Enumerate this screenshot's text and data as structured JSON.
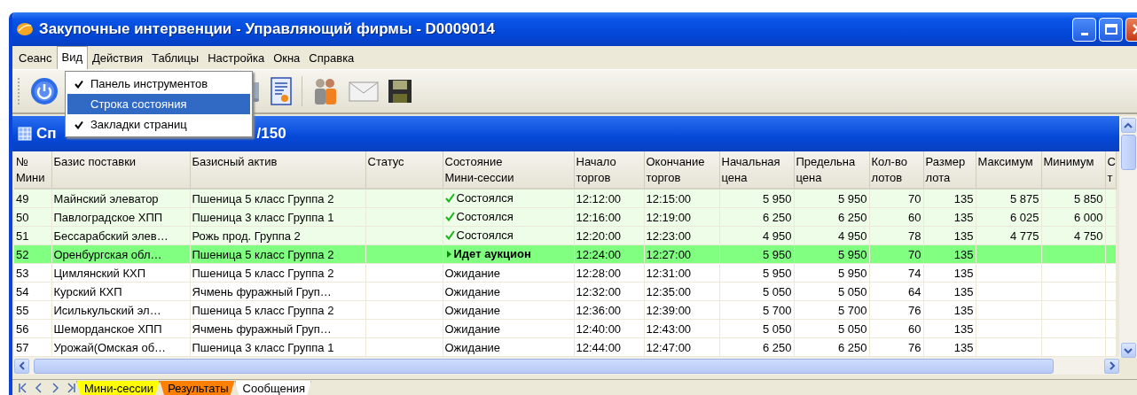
{
  "window": {
    "title": "Закупочные интервенции - Управляющий фирмы - D0009014"
  },
  "menu": [
    {
      "label": "Сеанс",
      "selected": false
    },
    {
      "label": "Вид",
      "selected": true
    },
    {
      "label": "Действия",
      "selected": false
    },
    {
      "label": "Таблицы",
      "selected": false
    },
    {
      "label": "Настройка",
      "selected": false
    },
    {
      "label": "Окна",
      "selected": false
    },
    {
      "label": "Справка",
      "selected": false
    }
  ],
  "dropdown": [
    {
      "label": "Панель инструментов",
      "checked": true,
      "selected": false
    },
    {
      "label": "Строка состояния",
      "checked": false,
      "selected": true
    },
    {
      "label": "Закладки страниц",
      "checked": true,
      "selected": false
    }
  ],
  "panel": {
    "title_start": "Сп",
    "title_end": "/150"
  },
  "table": {
    "columns": [
      {
        "label": "№\nМини"
      },
      {
        "label": "Базис поставки"
      },
      {
        "label": "Базисный актив"
      },
      {
        "label": "Статус"
      },
      {
        "label": "Состояние\nМини-сессии"
      },
      {
        "label": "Начало\nторгов"
      },
      {
        "label": "Окончание\nторгов"
      },
      {
        "label": "Начальная\nцена"
      },
      {
        "label": "Предельна\nцена"
      },
      {
        "label": "Кол-во\nлотов"
      },
      {
        "label": "Размер\nлота"
      },
      {
        "label": "Максимум"
      },
      {
        "label": "Минимум"
      },
      {
        "label": "С\nт"
      }
    ],
    "rows": [
      {
        "kind": "done",
        "no": "49",
        "basis": "Майнский элеватор",
        "asset": "Пшеница 5 класс Группа 2",
        "state": "Состоялся",
        "start": "12:12:00",
        "end": "12:15:00",
        "start_price": "5 950",
        "limit_price": "5 950",
        "lots": "70",
        "lot_size": "135",
        "max": "5 875",
        "min": "5 850"
      },
      {
        "kind": "done",
        "no": "50",
        "basis": "Павлоградское ХПП",
        "asset": "Пшеница 3 класс Группа 1",
        "state": "Состоялся",
        "start": "12:16:00",
        "end": "12:19:00",
        "start_price": "6 250",
        "limit_price": "6 250",
        "lots": "60",
        "lot_size": "135",
        "max": "6 025",
        "min": "6 000"
      },
      {
        "kind": "done",
        "no": "51",
        "basis": "Бессарабский элев…",
        "asset": "Рожь прод. Группа 2",
        "state": "Состоялся",
        "start": "12:20:00",
        "end": "12:23:00",
        "start_price": "4 950",
        "limit_price": "4 950",
        "lots": "78",
        "lot_size": "135",
        "max": "4 775",
        "min": "4 750"
      },
      {
        "kind": "active",
        "no": "52",
        "basis": "Оренбургская обл…",
        "asset": "Пшеница 5 класс Группа 2",
        "state": "Идет аукцион",
        "start": "12:24:00",
        "end": "12:27:00",
        "start_price": "5 950",
        "limit_price": "5 950",
        "lots": "70",
        "lot_size": "135"
      },
      {
        "kind": "waiting",
        "no": "53",
        "basis": "Цимлянский КХП",
        "asset": "Пшеница 5 класс Группа 2",
        "state": "Ожидание",
        "start": "12:28:00",
        "end": "12:31:00",
        "start_price": "5 950",
        "limit_price": "5 950",
        "lots": "74",
        "lot_size": "135"
      },
      {
        "kind": "waiting",
        "no": "54",
        "basis": "Курский КХП",
        "asset": "Ячмень фуражный Груп…",
        "state": "Ожидание",
        "start": "12:32:00",
        "end": "12:35:00",
        "start_price": "5 050",
        "limit_price": "5 050",
        "lots": "64",
        "lot_size": "135"
      },
      {
        "kind": "waiting",
        "no": "55",
        "basis": "Исилькульский эл…",
        "asset": "Пшеница 5 класс Группа 2",
        "state": "Ожидание",
        "start": "12:36:00",
        "end": "12:39:00",
        "start_price": "5 700",
        "limit_price": "5 700",
        "lots": "76",
        "lot_size": "135"
      },
      {
        "kind": "waiting",
        "no": "56",
        "basis": "Шеморданское ХПП",
        "asset": "Ячмень фуражный Груп…",
        "state": "Ожидание",
        "start": "12:40:00",
        "end": "12:43:00",
        "start_price": "5 050",
        "limit_price": "5 050",
        "lots": "60",
        "lot_size": "135"
      },
      {
        "kind": "waiting",
        "no": "57",
        "basis": "Урожай(Омская об…",
        "asset": "Пшеница 3 класс Группа 1",
        "state": "Ожидание",
        "start": "12:44:00",
        "end": "12:47:00",
        "start_price": "6 250",
        "limit_price": "6 250",
        "lots": "76",
        "lot_size": "135"
      }
    ]
  },
  "page_tabs": [
    {
      "label": "Мини-сессии",
      "color": "#ffff00",
      "selected": false
    },
    {
      "label": "Результаты",
      "color": "#ff8000",
      "selected": false
    },
    {
      "label": "Сообщения",
      "color": "#ffffff",
      "selected": true
    }
  ]
}
